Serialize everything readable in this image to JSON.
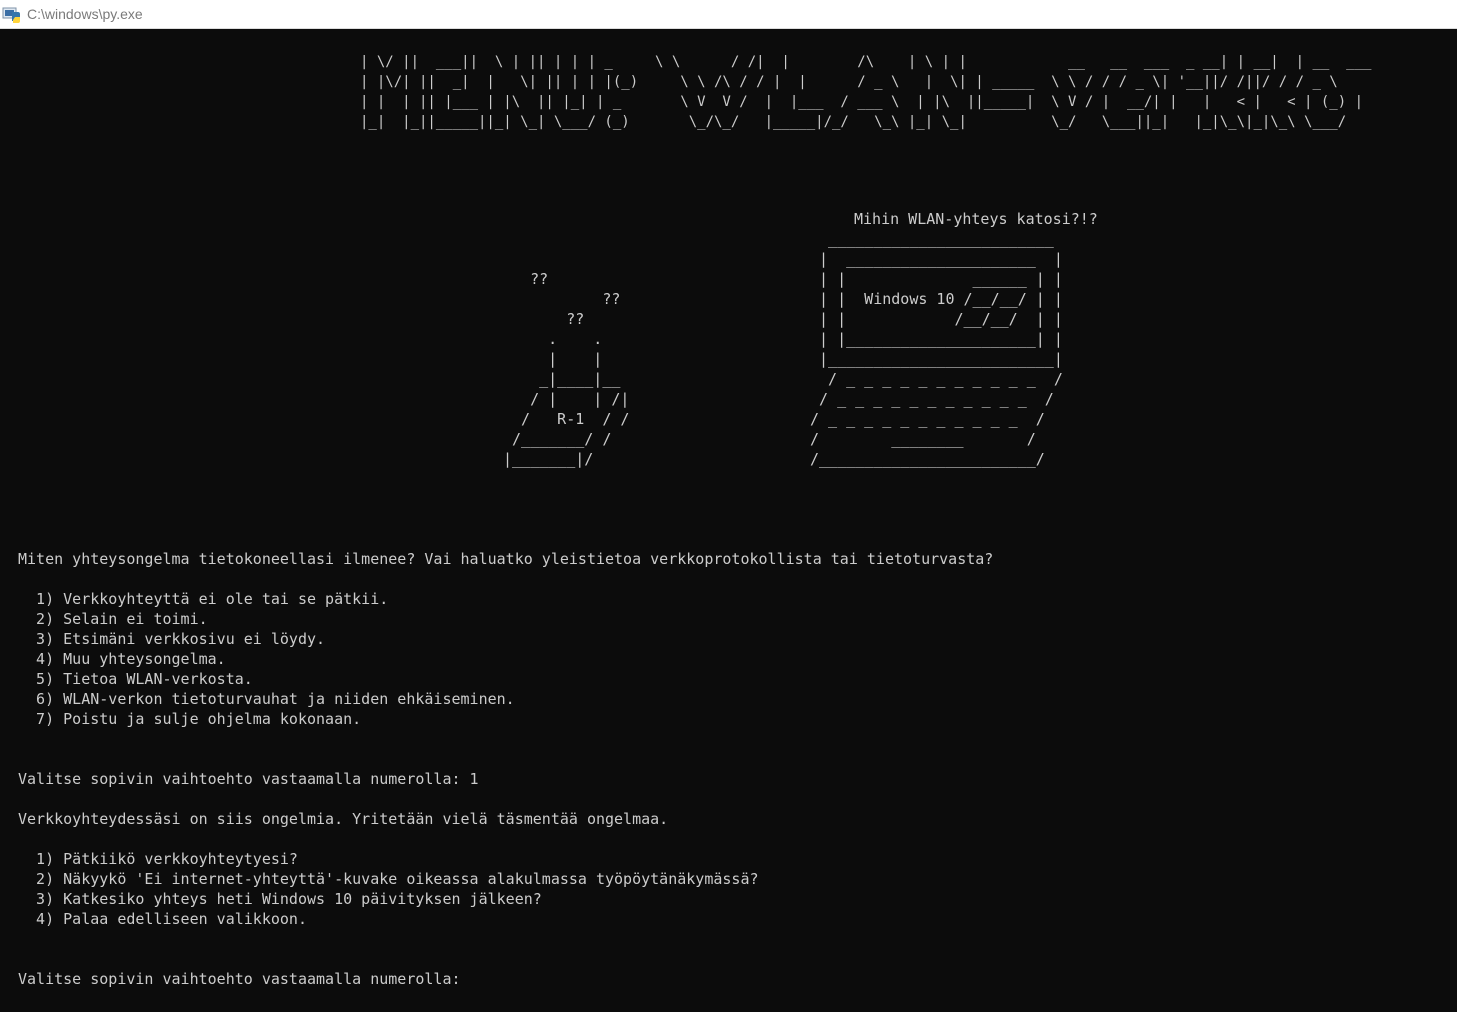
{
  "window": {
    "title": "C:\\windows\\py.exe",
    "app_icon": "python-launcher-icon"
  },
  "console": {
    "banner_art": "| \\/ ||  ___||  \\ | || | | | _     \\ \\      / /|  |        /\\    | \\ | |            __   __  ___  _ __| | __|  | __  ___\n| |\\/| ||  _|  |   \\| || | | |(_)     \\ \\ /\\ / / |  |      / _ \\   |  \\| | _____  \\ \\ / / / _ \\| '__||/ /||/ / / _ \\\n| |  | || |___ | |\\  || |_| | _       \\ V  V /  |  |___  / ___ \\  | |\\  ||_____|  \\ V / |  __/| |   |   < |   < | (_) |\n|_|  |_||_____||_| \\_| \\___/ (_)       \\_/\\_/   |_____|/_/   \\_\\ |_| \\_|          \\_/   \\___||_|   |_|\\_\\|_|\\_\\ \\___/",
    "tagline": "Mihin WLAN-yhteys katosi?!?",
    "router_art": "   ??\n           ??\n       ??\n     .    .\n     |    |\n    _|____|__\n   / |    | /|\n  /   R-1  / /\n /_______/ /\n|_______|/",
    "laptop_art": "  _________________________\n |  _____________________  |\n | |              ______ | |\n | |  Windows 10 /__/__/ | |\n | |            /__/__/  | |\n | |_____________________| |\n |_________________________|\n  / _ _ _ _ _ _ _ _ _ _ _  /\n / _ _ _ _ _ _ _ _ _ _ _  /\n/ _ _ _ _ _ _ _ _ _ _ _  /\n/        ________       /\n/________________________/",
    "transcript": [
      "Miten yhteysongelma tietokoneellasi ilmenee? Vai haluatko yleistietoa verkkoprotokollista tai tietoturvasta?",
      "",
      "  1) Verkkoyhteyttä ei ole tai se pätkii.",
      "  2) Selain ei toimi.",
      "  3) Etsimäni verkkosivu ei löydy.",
      "  4) Muu yhteysongelma.",
      "  5) Tietoa WLAN-verkosta.",
      "  6) WLAN-verkon tietoturvauhat ja niiden ehkäiseminen.",
      "  7) Poistu ja sulje ohjelma kokonaan.",
      "",
      "",
      "Valitse sopivin vaihtoehto vastaamalla numerolla: 1",
      "",
      "Verkkoyhteydessäsi on siis ongelmia. Yritetään vielä täsmentää ongelmaa.",
      "",
      "  1) Pätkiikö verkkoyhteytyesi?",
      "  2) Näkyykö 'Ei internet-yhteyttä'-kuvake oikeassa alakulmassa työpöytänäkymässä?",
      "  3) Katkesiko yhteys heti Windows 10 päivityksen jälkeen?",
      "  4) Palaa edelliseen valikkoon.",
      "",
      "",
      "Valitse sopivin vaihtoehto vastaamalla numerolla:"
    ]
  }
}
